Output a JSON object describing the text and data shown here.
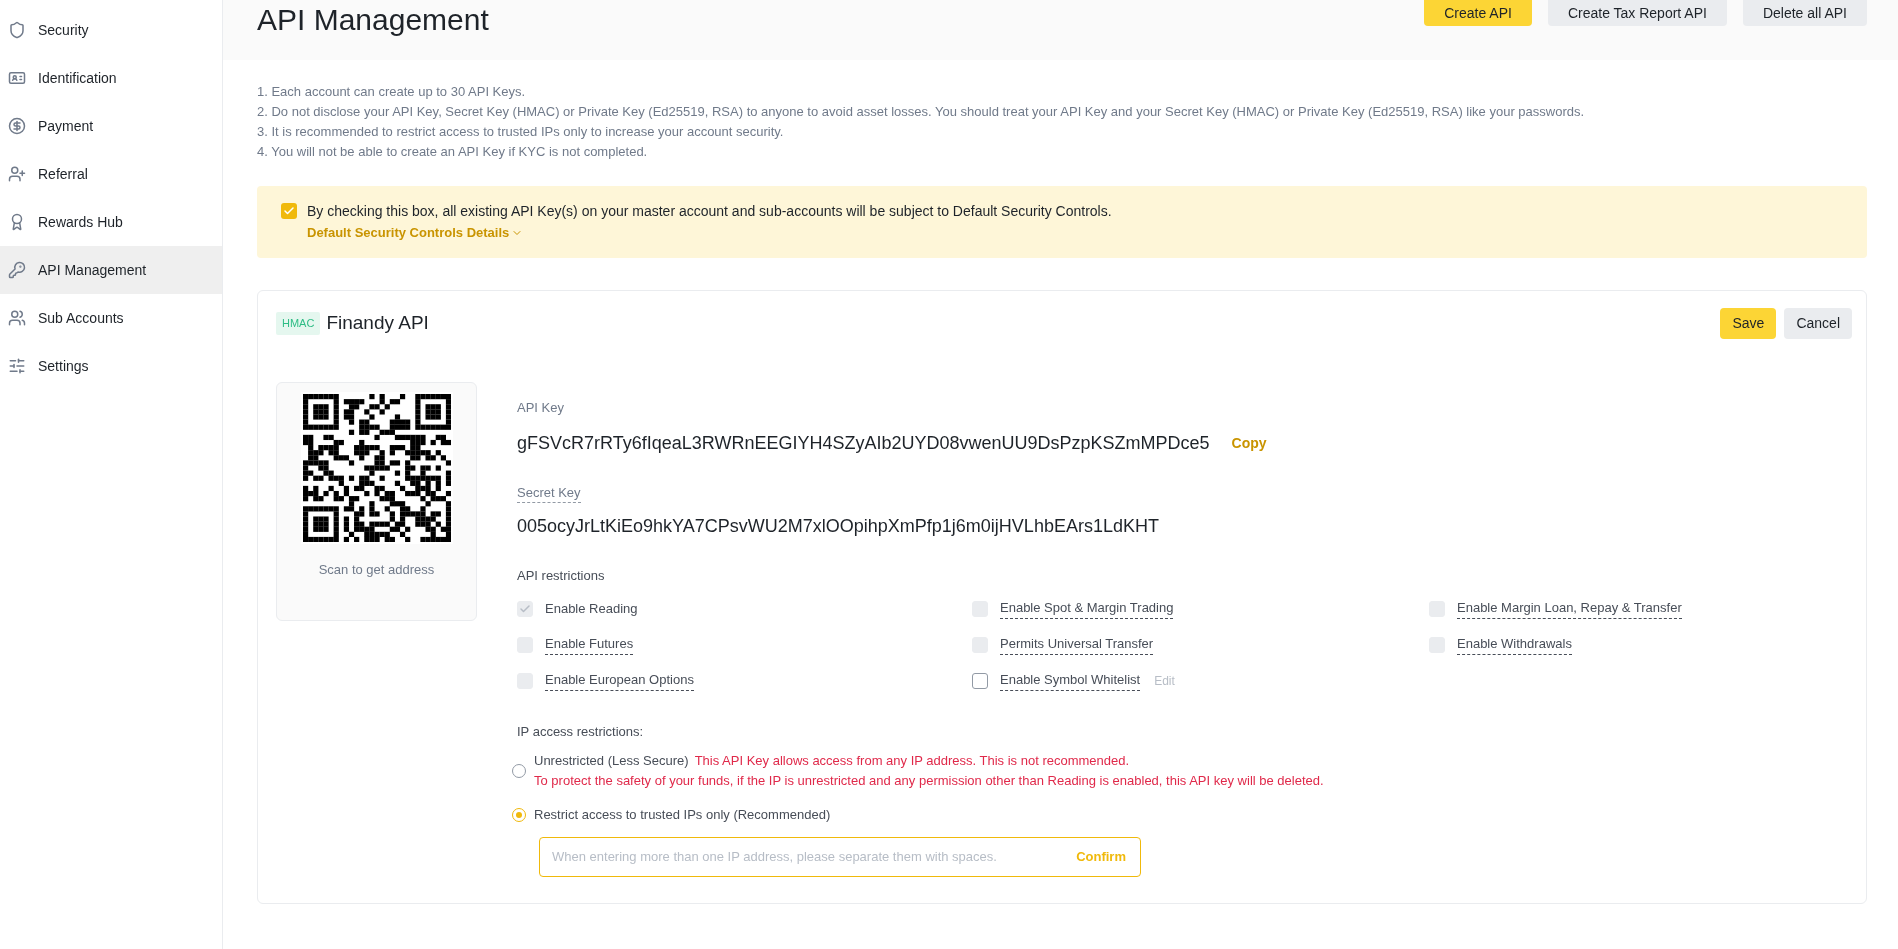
{
  "sidebar": {
    "items": [
      {
        "label": "Security",
        "selected": false
      },
      {
        "label": "Identification",
        "selected": false
      },
      {
        "label": "Payment",
        "selected": false
      },
      {
        "label": "Referral",
        "selected": false
      },
      {
        "label": "Rewards Hub",
        "selected": false
      },
      {
        "label": "API Management",
        "selected": true
      },
      {
        "label": "Sub Accounts",
        "selected": false
      },
      {
        "label": "Settings",
        "selected": false
      }
    ]
  },
  "header": {
    "title": "API Management",
    "buttons": [
      {
        "label": "Create API",
        "kind": "primary"
      },
      {
        "label": "Create Tax Report API",
        "kind": "secondary"
      },
      {
        "label": "Delete all API",
        "kind": "secondary"
      }
    ]
  },
  "notes": [
    "1. Each account can create up to 30 API Keys.",
    "2. Do not disclose your API Key, Secret Key (HMAC) or Private Key (Ed25519, RSA) to anyone to avoid asset losses. You should treat your API Key and your Secret Key (HMAC) or Private Key (Ed25519, RSA) like your passwords.",
    "3. It is recommended to restrict access to trusted IPs only to increase your account security.",
    "4. You will not be able to create an API Key if KYC is not completed."
  ],
  "banner": {
    "checked": true,
    "text": "By checking this box, all existing API Key(s) on your master account and sub-accounts will be subject to Default Security Controls.",
    "link": "Default Security Controls Details"
  },
  "api_card": {
    "badge": "HMAC",
    "name": "Finandy API",
    "buttons": [
      {
        "label": "Save",
        "kind": "primary"
      },
      {
        "label": "Cancel",
        "kind": "secondary"
      }
    ],
    "qr_caption": "Scan to get address",
    "api_key_label": "API Key",
    "api_key": "gFSVcR7rRTy6fIqeaL3RWRnEEGIYH4SZyAIb2UYD08vwenUU9DsPzpKSZmMPDce5",
    "copy": "Copy",
    "secret_key_label": "Secret Key",
    "secret_key": "005ocyJrLtKiEo9hkYA7CPsvWU2M7xlOOpihpXmPfp1j6m0ijHVLhbEArs1LdKHT",
    "restrictions_label": "API restrictions",
    "restrictions": [
      {
        "label": "Enable Reading",
        "checked": true,
        "disabled": true,
        "tooltip": false
      },
      {
        "label": "Enable Spot & Margin Trading",
        "checked": false,
        "disabled": true,
        "tooltip": true
      },
      {
        "label": "Enable Margin Loan, Repay & Transfer",
        "checked": false,
        "disabled": true,
        "tooltip": true
      },
      {
        "label": "Enable Futures",
        "checked": false,
        "disabled": true,
        "tooltip": true
      },
      {
        "label": "Permits Universal Transfer",
        "checked": false,
        "disabled": true,
        "tooltip": true
      },
      {
        "label": "Enable Withdrawals",
        "checked": false,
        "disabled": true,
        "tooltip": true
      },
      {
        "label": "Enable European Options",
        "checked": false,
        "disabled": true,
        "tooltip": true
      },
      {
        "label": "Enable Symbol Whitelist",
        "checked": false,
        "disabled": false,
        "tooltip": true,
        "edit": "Edit"
      }
    ],
    "ip_label": "IP access restrictions:",
    "ip_options": [
      {
        "label": "Unrestricted (Less Secure)",
        "selected": false,
        "warnings": [
          "This API Key allows access from any IP address. This is not recommended.",
          "To protect the safety of your funds, if the IP is unrestricted and any permission other than Reading is enabled, this API key will be deleted."
        ]
      },
      {
        "label": "Restrict access to trusted IPs only (Recommended)",
        "selected": true
      }
    ],
    "ip_input": {
      "placeholder": "When entering more than one IP address, please separate them with spaces.",
      "button": "Confirm"
    }
  }
}
